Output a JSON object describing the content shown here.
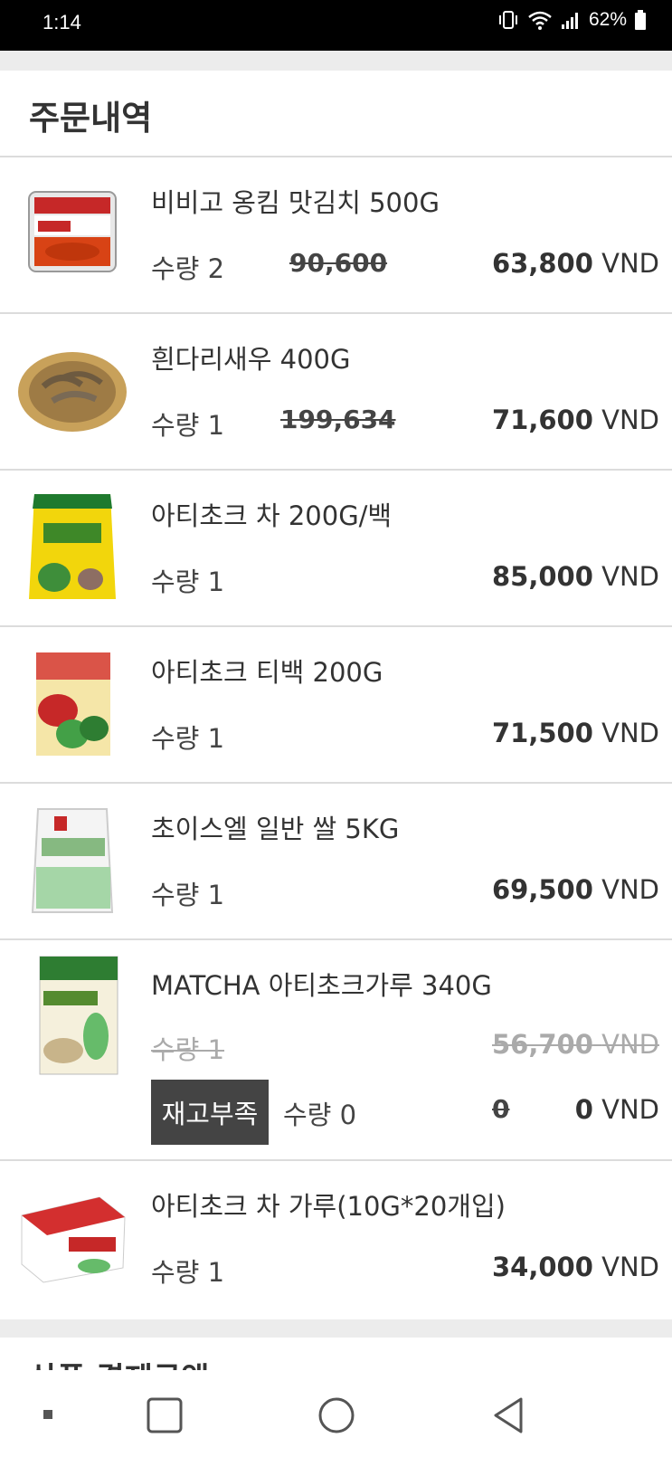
{
  "status_bar": {
    "time": "1:14",
    "battery": "62%"
  },
  "header": {
    "title": "주문내역"
  },
  "items": [
    {
      "name": "비비고 옹킴 맛김치 500G",
      "qty": "수량 2",
      "orig_price": "90,600",
      "price": "63,800",
      "currency": "VND"
    },
    {
      "name": "흰다리새우 400G",
      "qty": "수량 1",
      "orig_price": "199,634",
      "price": "71,600",
      "currency": "VND"
    },
    {
      "name": "아티초크 차 200G/백",
      "qty": "수량 1",
      "price": "85,000",
      "currency": "VND"
    },
    {
      "name": "아티초크 티백 200G",
      "qty": "수량 1",
      "price": "71,500",
      "currency": "VND"
    },
    {
      "name": "초이스엘 일반 쌀 5KG",
      "qty": "수량 1",
      "price": "69,500",
      "currency": "VND"
    },
    {
      "name": "MATCHA 아티초크가루 340G",
      "qty_old": "수량 1",
      "price_old": "56,700",
      "currency_old": "VND",
      "badge": "재고부족",
      "qty": "수량 0",
      "orig_price": "0",
      "price": "0",
      "currency": "VND"
    },
    {
      "name": "아티초크 차 가루(10G*20개입)",
      "qty": "수량 1",
      "price": "34,000",
      "currency": "VND"
    }
  ],
  "next_section": {
    "title": "상품 결제금액"
  },
  "nav": {
    "recent": "recent-apps-icon",
    "home": "home-icon",
    "back": "back-icon"
  }
}
